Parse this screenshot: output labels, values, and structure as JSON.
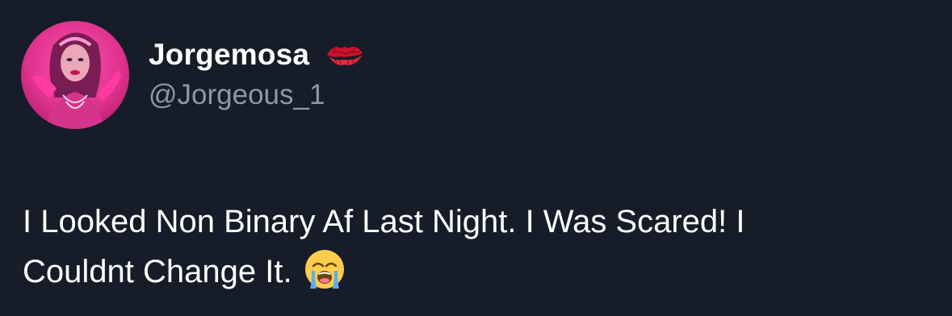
{
  "user": {
    "display_name": "Jorgemosa",
    "handle": "@Jorgeous_1",
    "badge_icon": "kiss-mark-icon",
    "avatar_icon": "profile-avatar"
  },
  "tweet": {
    "text_line_1": "I Looked Non Binary Af Last Night. I Was Scared! I",
    "text_line_2": "Couldnt Change It.",
    "trailing_emoji": "loudly-crying-face-icon"
  },
  "colors": {
    "background": "#161d28",
    "primary_text": "#ffffff",
    "secondary_text": "#8b98a5",
    "avatar_accent": "#e0338f"
  }
}
